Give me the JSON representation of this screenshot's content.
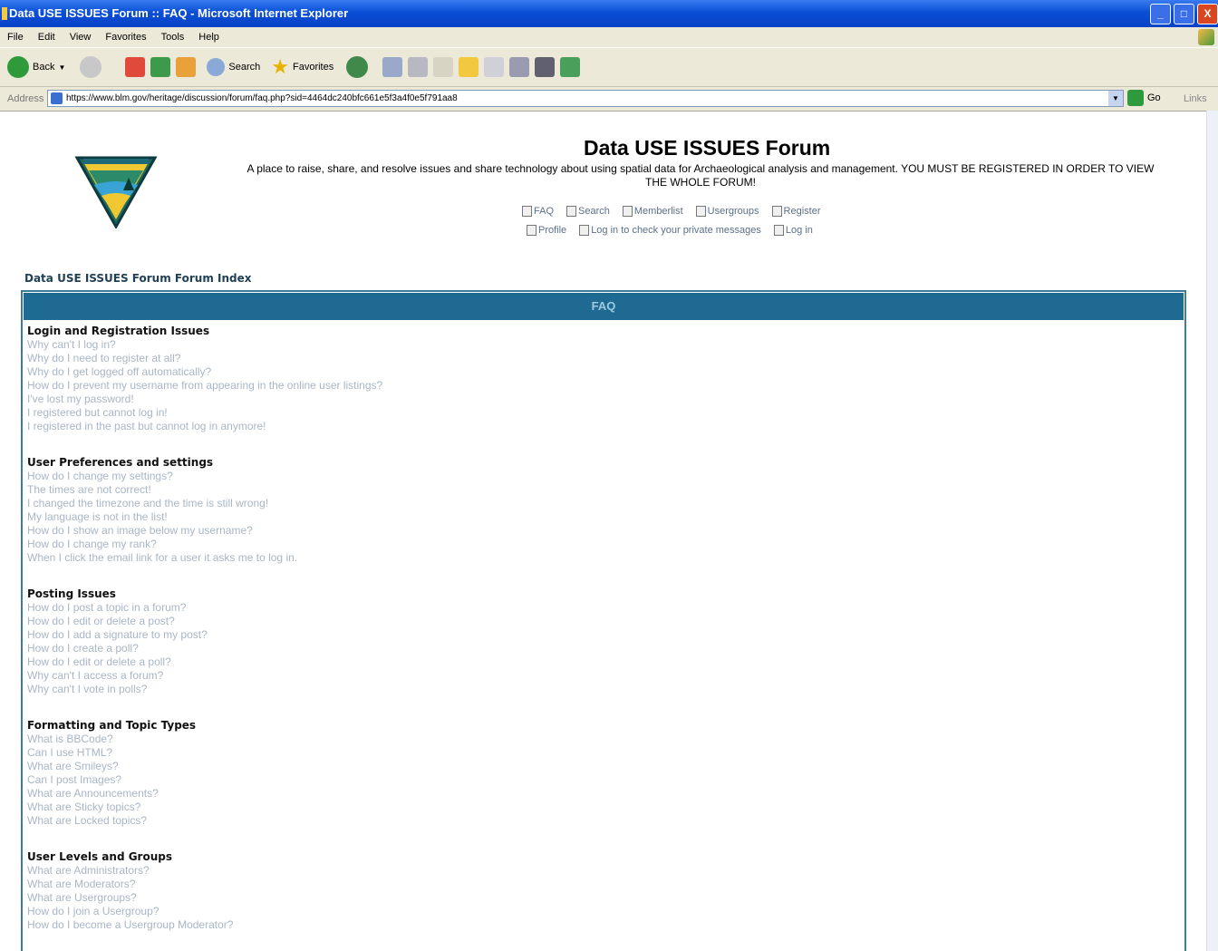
{
  "window": {
    "title": "Data USE ISSUES Forum :: FAQ - Microsoft Internet Explorer",
    "minimize": "_",
    "maximize": "□",
    "close": "X"
  },
  "menu": [
    "File",
    "Edit",
    "View",
    "Favorites",
    "Tools",
    "Help"
  ],
  "toolbar": {
    "back": "Back",
    "search": "Search",
    "favorites": "Favorites"
  },
  "address": {
    "label": "Address",
    "url": "https://www.blm.gov/heritage/discussion/forum/faq.php?sid=4464dc240bfc661e5f3a4f0e5f791aa8",
    "go": "Go",
    "links": "Links"
  },
  "site": {
    "title": "Data USE ISSUES Forum",
    "description": "A place to raise, share, and resolve issues and share technology about using spatial data for Archaeological analysis and management. YOU MUST BE REGISTERED IN ORDER TO VIEW THE WHOLE FORUM!",
    "nav_row1": [
      "FAQ",
      "Search",
      "Memberlist",
      "Usergroups",
      "Register"
    ],
    "nav_row2": [
      "Profile",
      "Log in to check your private messages",
      "Log in"
    ],
    "breadcrumb": "Data USE ISSUES Forum Forum Index"
  },
  "faq": {
    "header": "FAQ",
    "sections": [
      {
        "title": "Login and Registration Issues",
        "questions": [
          "Why can't I log in?",
          "Why do I need to register at all?",
          "Why do I get logged off automatically?",
          "How do I prevent my username from appearing in the online user listings?",
          "I've lost my password!",
          "I registered but cannot log in!",
          "I registered in the past but cannot log in anymore!"
        ]
      },
      {
        "title": "User Preferences and settings",
        "questions": [
          "How do I change my settings?",
          "The times are not correct!",
          "I changed the timezone and the time is still wrong!",
          "My language is not in the list!",
          "How do I show an image below my username?",
          "How do I change my rank?",
          "When I click the email link for a user it asks me to log in."
        ]
      },
      {
        "title": "Posting Issues",
        "questions": [
          "How do I post a topic in a forum?",
          "How do I edit or delete a post?",
          "How do I add a signature to my post?",
          "How do I create a poll?",
          "How do I edit or delete a poll?",
          "Why can't I access a forum?",
          "Why can't I vote in polls?"
        ]
      },
      {
        "title": "Formatting and Topic Types",
        "questions": [
          "What is BBCode?",
          "Can I use HTML?",
          "What are Smileys?",
          "Can I post Images?",
          "What are Announcements?",
          "What are Sticky topics?",
          "What are Locked topics?"
        ]
      },
      {
        "title": "User Levels and Groups",
        "questions": [
          "What are Administrators?",
          "What are Moderators?",
          "What are Usergroups?",
          "How do I join a Usergroup?",
          "How do I become a Usergroup Moderator?"
        ]
      }
    ]
  }
}
